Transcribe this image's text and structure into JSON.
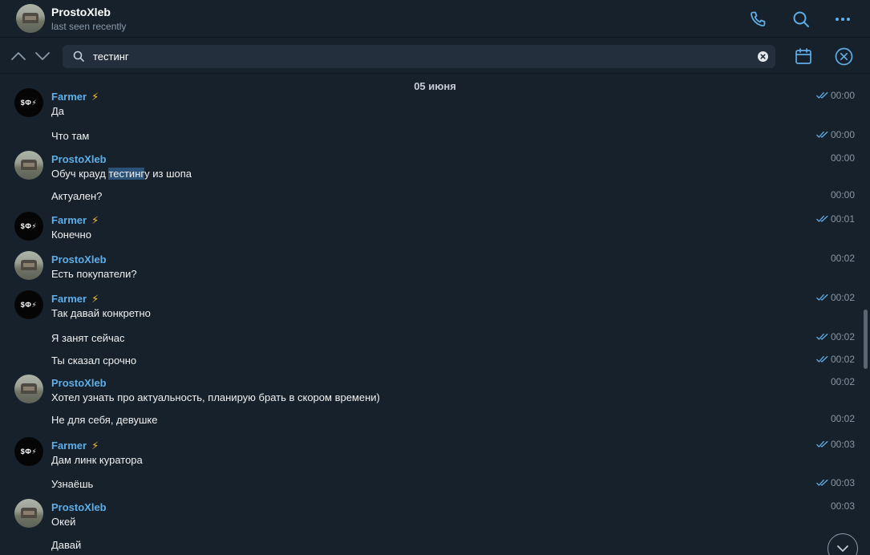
{
  "header": {
    "name": "ProstoXleb",
    "status": "last seen recently"
  },
  "search": {
    "value": "тестинг",
    "placeholder": ""
  },
  "date_separator": "05 июня",
  "farmer_avatar_text": "$Ф⚡",
  "icons": {
    "phone": "phone-icon",
    "search": "search-icon",
    "more": "more-icon",
    "calendar": "calendar-icon",
    "close": "close-icon"
  },
  "colors": {
    "accent": "#5eaee8",
    "background": "#17212b",
    "highlight": "#2b5278",
    "bolt": "#f5c32c"
  },
  "messages": [
    {
      "sender": "Farmer",
      "bolt": "⚡",
      "avatar": "farmer",
      "text": "Да",
      "time": "00:00",
      "read": true
    },
    {
      "sender": "",
      "text": "Что там",
      "time": "00:00",
      "read": true
    },
    {
      "sender": "ProstoXleb",
      "avatar": "prosto",
      "text_before": "Обуч крауд ",
      "text_highlight": "тестинг",
      "text_after": "у из шопа",
      "time": "00:00",
      "read": false
    },
    {
      "sender": "",
      "text": "Актуален?",
      "time": "00:00",
      "read": false
    },
    {
      "sender": "Farmer",
      "bolt": "⚡",
      "avatar": "farmer",
      "text": "Конечно",
      "time": "00:01",
      "read": true
    },
    {
      "sender": "ProstoXleb",
      "avatar": "prosto",
      "text": "Есть покупатели?",
      "time": "00:02",
      "read": false
    },
    {
      "sender": "Farmer",
      "bolt": "⚡",
      "avatar": "farmer",
      "text": "Так давай конкретно",
      "time": "00:02",
      "read": true
    },
    {
      "sender": "",
      "text": "Я занят сейчас",
      "time": "00:02",
      "read": true
    },
    {
      "sender": "",
      "text": "Ты сказал срочно",
      "time": "00:02",
      "read": true
    },
    {
      "sender": "ProstoXleb",
      "avatar": "prosto",
      "text": "Хотел узнать про актуальность, планирую брать в скором времени)",
      "time": "00:02",
      "read": false
    },
    {
      "sender": "",
      "text": "Не для себя, девушке",
      "time": "00:02",
      "read": false
    },
    {
      "sender": "Farmer",
      "bolt": "⚡",
      "avatar": "farmer",
      "text": "Дам линк куратора",
      "time": "00:03",
      "read": true
    },
    {
      "sender": "",
      "text": "Узнаёшь",
      "time": "00:03",
      "read": true
    },
    {
      "sender": "ProstoXleb",
      "avatar": "prosto",
      "text": "Окей",
      "time": "00:03",
      "read": false
    },
    {
      "sender": "",
      "text": "Давай",
      "time": "",
      "read": false
    }
  ]
}
